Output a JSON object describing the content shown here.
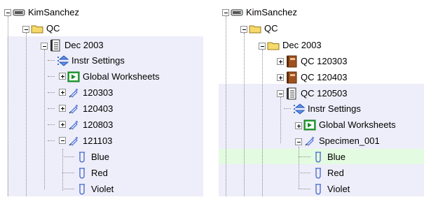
{
  "left_tree": {
    "root": "KimSanchez",
    "group": "QC",
    "folder": "Dec 2003",
    "instr_settings": "Instr Settings",
    "global_worksheets": "Global Worksheets",
    "runs": [
      "120303",
      "120403",
      "120803",
      "121103"
    ],
    "tubes": [
      "Blue",
      "Red",
      "Violet"
    ]
  },
  "right_tree": {
    "root": "KimSanchez",
    "group": "QC",
    "folder": "Dec 2003",
    "experiments": [
      "QC 120303",
      "QC 120403",
      "QC 120503"
    ],
    "instr_settings": "Instr Settings",
    "global_worksheets": "Global Worksheets",
    "specimen": "Specimen_001",
    "tubes": [
      "Blue",
      "Red",
      "Violet"
    ]
  },
  "colors": {
    "selection_band": "#eeeefa",
    "highlight_row": "#e3fbe0",
    "folder_yellow": "#f5d96a",
    "experiment_brown": "#a0521e",
    "global_green": "#2eae3c",
    "tube_blue": "#4466cc"
  }
}
